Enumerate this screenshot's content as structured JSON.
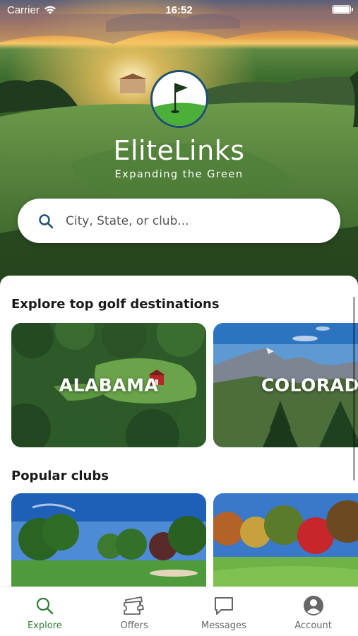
{
  "status_bar": {
    "carrier": "Carrier",
    "time": "16:52"
  },
  "brand": {
    "name": "EliteLinks",
    "tagline": "Expanding the Green"
  },
  "search": {
    "placeholder": "City, State, or club..."
  },
  "destinations": {
    "title": "Explore top golf destinations",
    "items": [
      {
        "label": "ALABAMA"
      },
      {
        "label": "COLORADO"
      }
    ]
  },
  "clubs": {
    "title": "Popular clubs"
  },
  "tabs": [
    {
      "label": "Explore",
      "icon": "search-icon",
      "active": true
    },
    {
      "label": "Offers",
      "icon": "ticket-icon",
      "active": false
    },
    {
      "label": "Messages",
      "icon": "chat-bubble-icon",
      "active": false
    },
    {
      "label": "Account",
      "icon": "user-circle-icon",
      "active": false
    }
  ],
  "colors": {
    "active_tab": "#2e7d32",
    "inactive_tab": "#666666",
    "search_icon": "#1d4f6e"
  }
}
